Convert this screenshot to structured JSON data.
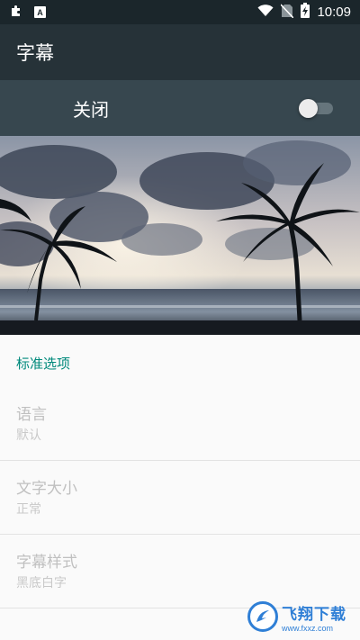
{
  "status_bar": {
    "time": "10:09",
    "left_icons": [
      "puzzle-icon",
      "app-badge-icon"
    ],
    "right_icons": [
      "wifi-icon",
      "no-sim-icon",
      "battery-charging-icon"
    ],
    "badge_letter": "A"
  },
  "toolbar": {
    "title": "字幕"
  },
  "master_switch": {
    "label": "关闭",
    "enabled": false
  },
  "preview": {
    "description_icon": "beach-sunset-image"
  },
  "preferences": {
    "section_header": "标准选项",
    "items": [
      {
        "title": "语言",
        "summary": "默认"
      },
      {
        "title": "文字大小",
        "summary": "正常"
      },
      {
        "title": "字幕样式",
        "summary": "黑底白字"
      }
    ]
  },
  "watermark": {
    "name": "飞翔下载",
    "url": "www.fxxz.com"
  },
  "colors": {
    "status_bar": "#1b262b",
    "toolbar": "#263238",
    "switch_row": "#37474f",
    "accent": "#00897b"
  }
}
